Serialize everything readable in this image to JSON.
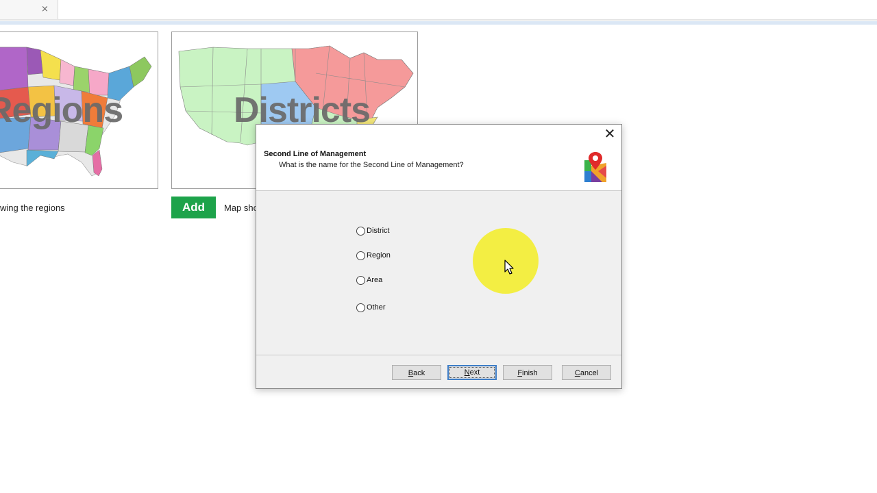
{
  "browser": {
    "tab_close_glyph": "×"
  },
  "cards": {
    "regions": {
      "word": "Regions",
      "description": "wing the regions"
    },
    "districts": {
      "word": "Districts",
      "add_label": "Add",
      "description": "Map sho"
    }
  },
  "dialog": {
    "close_glyph": "✕",
    "title": "Second Line of Management",
    "subtitle": "What is the name for the Second Line of Management?",
    "logo_icon": "map-pin-logo-icon",
    "options": [
      {
        "label": "District",
        "checked": false
      },
      {
        "label": "Region",
        "checked": false
      },
      {
        "label": "Area",
        "checked": false
      },
      {
        "label": "Other",
        "checked": false
      }
    ],
    "buttons": {
      "back": {
        "label": "Back",
        "accel": "B",
        "rest": "ack"
      },
      "next": {
        "label": "Next",
        "accel": "N",
        "rest": "ext"
      },
      "finish": {
        "label": "Finish",
        "accel": "F",
        "rest": "inish"
      },
      "cancel": {
        "label": "Cancel",
        "accel": "C",
        "rest": "ancel"
      }
    }
  },
  "colors": {
    "add_button": "#1da34a",
    "dialog_bg": "#f0f0f0",
    "highlight": "#f3ee34",
    "default_button_border": "#3f7ec7"
  }
}
